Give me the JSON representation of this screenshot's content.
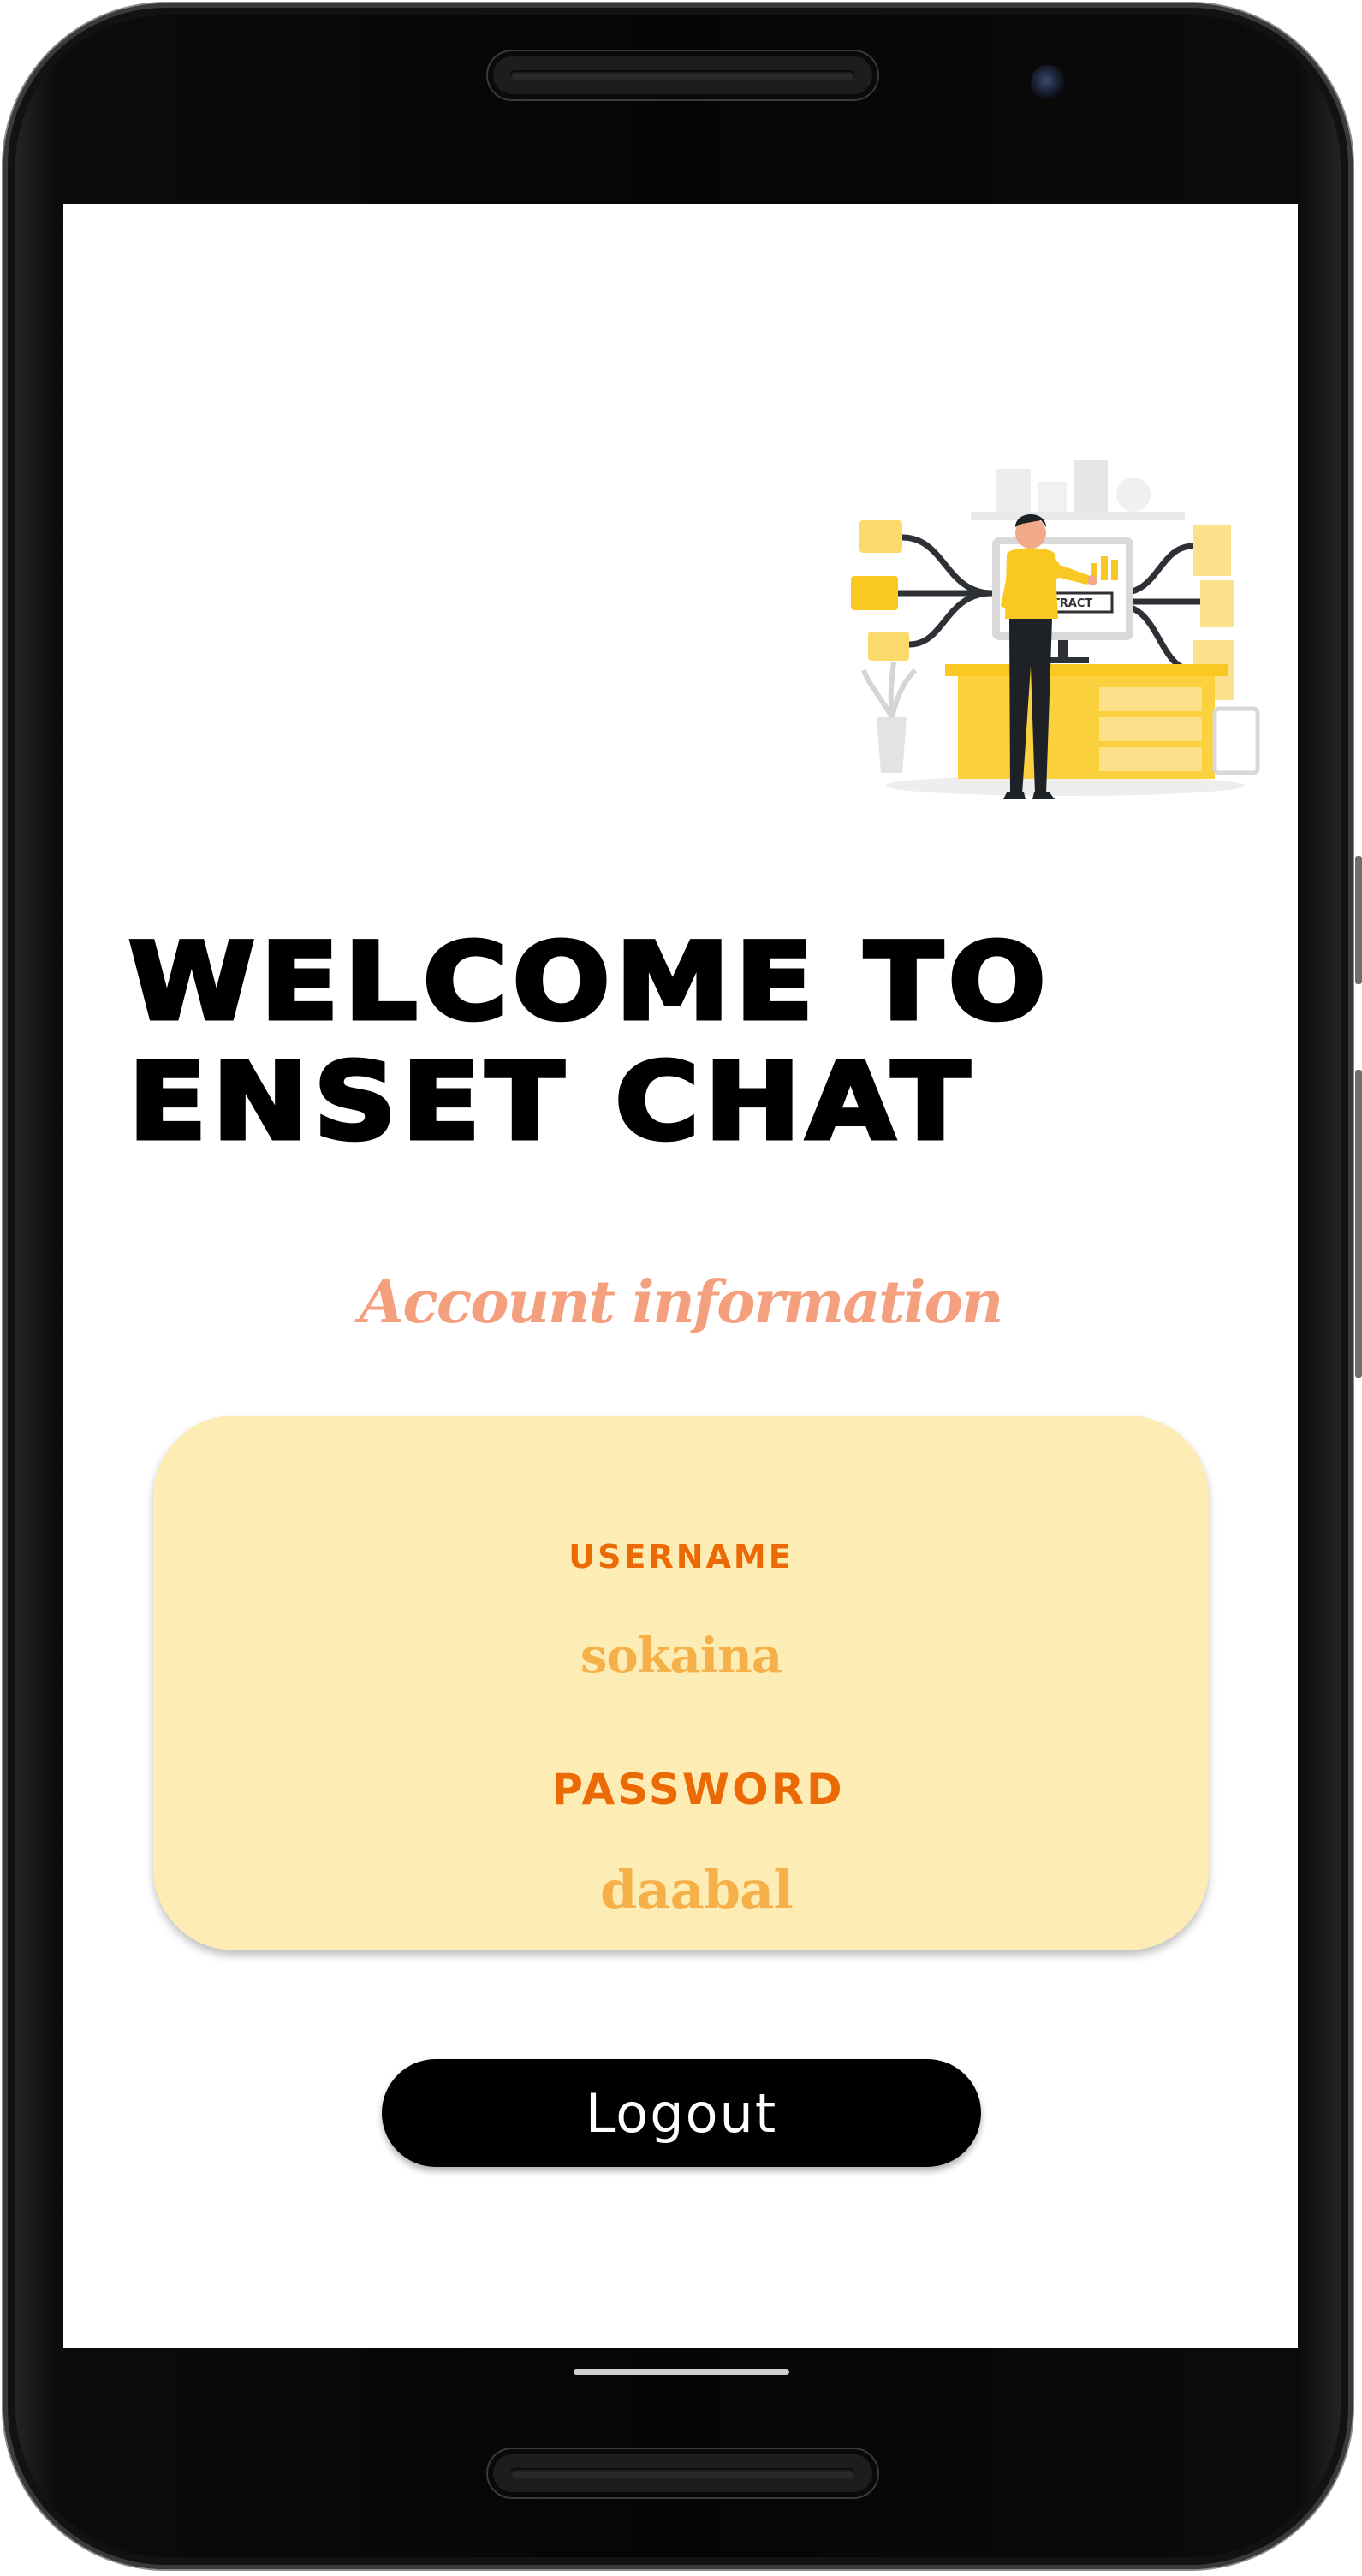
{
  "header": {
    "welcome_line1": "WELCOME TO",
    "welcome_line2": "ENSET CHAT"
  },
  "section": {
    "title": "Account information"
  },
  "account": {
    "username_label": "USERNAME",
    "username_value": "sokaina",
    "password_label": "PASSWORD",
    "password_value": "daabal"
  },
  "actions": {
    "logout_label": "Logout"
  },
  "illustration": {
    "sign_text": "EXTRACT"
  },
  "colors": {
    "subtitle": "#f4a07f",
    "card_background": "#fdecb3",
    "label": "#ec6a06",
    "value": "#f6b04a",
    "button_background": "#000000",
    "accent_yellow": "#f9c822"
  }
}
